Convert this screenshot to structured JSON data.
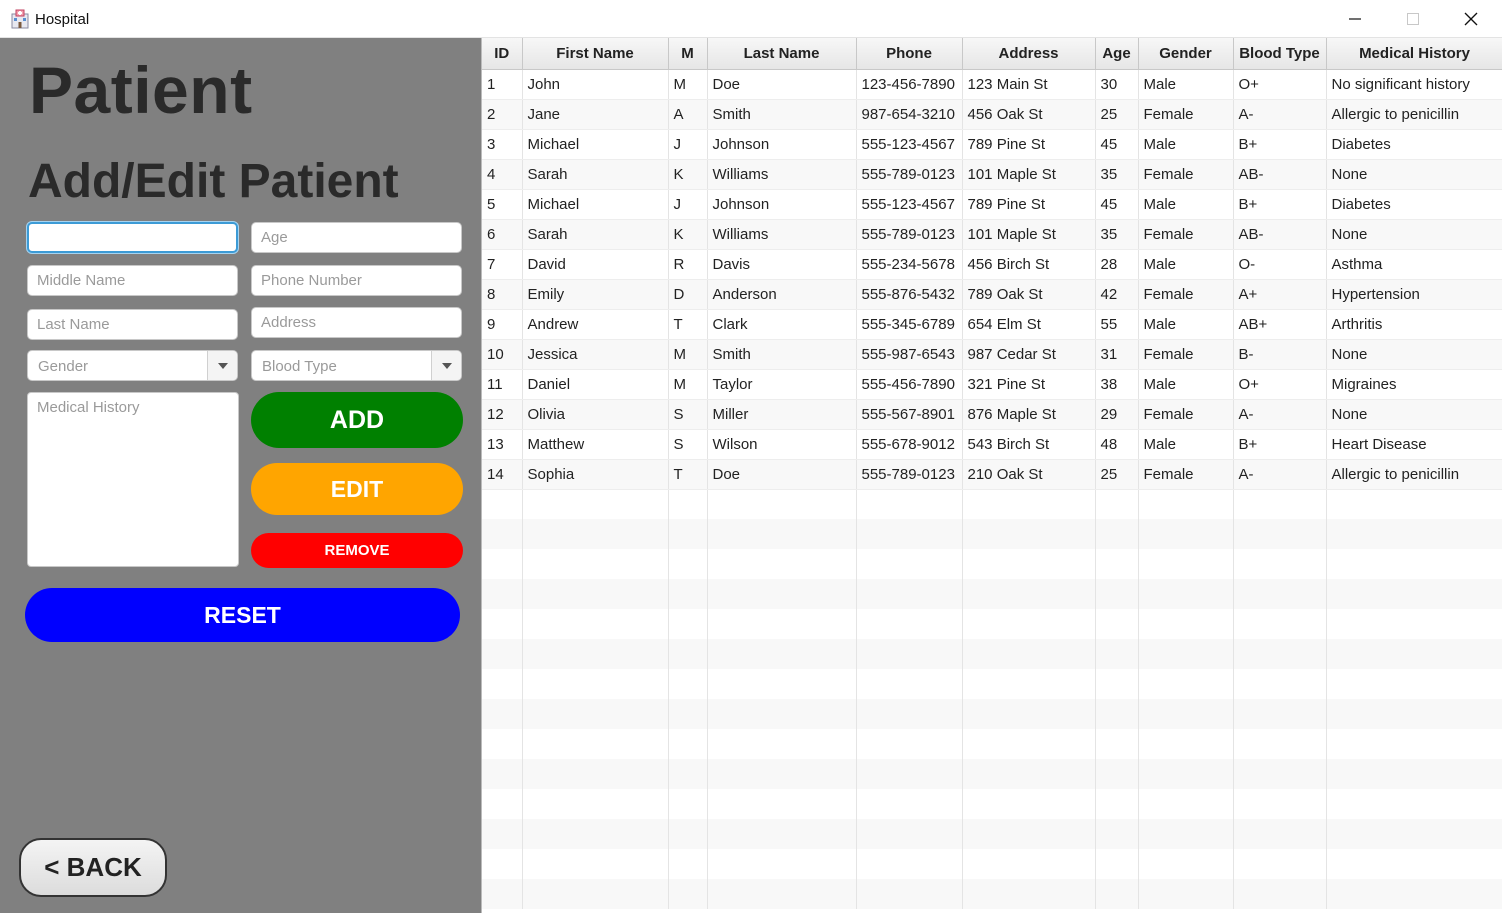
{
  "window": {
    "title": "Hospital",
    "controls": {
      "minimize": "—",
      "maximize": "☐",
      "close": "✕"
    }
  },
  "left": {
    "page_title": "Patient",
    "section_title": "Add/Edit Patient",
    "fields": {
      "first_name": {
        "value": "",
        "placeholder": ""
      },
      "age": {
        "value": "",
        "placeholder": "Age"
      },
      "middle_name": {
        "value": "",
        "placeholder": "Middle Name"
      },
      "phone": {
        "value": "",
        "placeholder": "Phone Number"
      },
      "last_name": {
        "value": "",
        "placeholder": "Last Name"
      },
      "address": {
        "value": "",
        "placeholder": "Address"
      },
      "gender": {
        "placeholder": "Gender"
      },
      "blood_type": {
        "placeholder": "Blood Type"
      },
      "medical_history": {
        "placeholder": "Medical History"
      }
    },
    "buttons": {
      "add": "ADD",
      "edit": "EDIT",
      "remove": "REMOVE",
      "reset": "RESET",
      "back": "< BACK"
    }
  },
  "table": {
    "columns": [
      "ID",
      "First Name",
      "M",
      "Last Name",
      "Phone",
      "Address",
      "Age",
      "Gender",
      "Blood Type",
      "Medical History"
    ],
    "rows": [
      [
        "1",
        "John",
        "M",
        "Doe",
        "123-456-7890",
        "123 Main St",
        "30",
        "Male",
        "O+",
        "No significant history"
      ],
      [
        "2",
        "Jane",
        "A",
        "Smith",
        "987-654-3210",
        "456 Oak St",
        "25",
        "Female",
        "A-",
        "Allergic to penicillin"
      ],
      [
        "3",
        "Michael",
        "J",
        "Johnson",
        "555-123-4567",
        "789 Pine St",
        "45",
        "Male",
        "B+",
        "Diabetes"
      ],
      [
        "4",
        "Sarah",
        "K",
        "Williams",
        "555-789-0123",
        "101 Maple St",
        "35",
        "Female",
        "AB-",
        "None"
      ],
      [
        "5",
        "Michael",
        "J",
        "Johnson",
        "555-123-4567",
        "789 Pine St",
        "45",
        "Male",
        "B+",
        "Diabetes"
      ],
      [
        "6",
        "Sarah",
        "K",
        "Williams",
        "555-789-0123",
        "101 Maple St",
        "35",
        "Female",
        "AB-",
        "None"
      ],
      [
        "7",
        "David",
        "R",
        "Davis",
        "555-234-5678",
        "456 Birch St",
        "28",
        "Male",
        "O-",
        "Asthma"
      ],
      [
        "8",
        "Emily",
        "D",
        "Anderson",
        "555-876-5432",
        "789 Oak St",
        "42",
        "Female",
        "A+",
        "Hypertension"
      ],
      [
        "9",
        "Andrew",
        "T",
        "Clark",
        "555-345-6789",
        "654 Elm St",
        "55",
        "Male",
        "AB+",
        "Arthritis"
      ],
      [
        "10",
        "Jessica",
        "M",
        "Smith",
        "555-987-6543",
        "987 Cedar St",
        "31",
        "Female",
        "B-",
        "None"
      ],
      [
        "11",
        "Daniel",
        "M",
        "Taylor",
        "555-456-7890",
        "321 Pine St",
        "38",
        "Male",
        "O+",
        "Migraines"
      ],
      [
        "12",
        "Olivia",
        "S",
        "Miller",
        "555-567-8901",
        "876 Maple St",
        "29",
        "Female",
        "A-",
        "None"
      ],
      [
        "13",
        "Matthew",
        "S",
        "Wilson",
        "555-678-9012",
        "543 Birch St",
        "48",
        "Male",
        "B+",
        "Heart Disease"
      ],
      [
        "14",
        "Sophia",
        "T",
        "Doe",
        "555-789-0123",
        "210 Oak St",
        "25",
        "Female",
        "A-",
        "Allergic to penicillin"
      ]
    ]
  },
  "colors": {
    "panel": "#808080",
    "add": "#008000",
    "edit": "#ffa500",
    "remove": "#ff0000",
    "reset": "#0000ff"
  }
}
